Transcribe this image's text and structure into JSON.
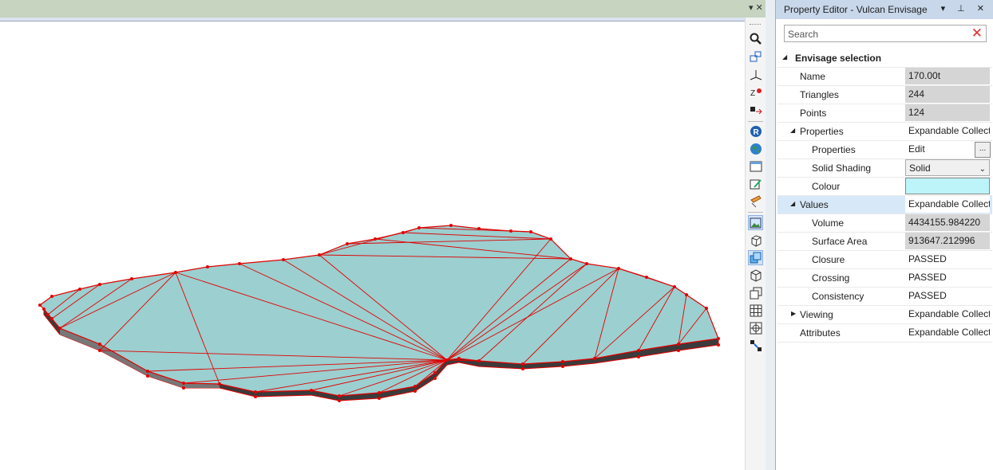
{
  "panel": {
    "title": "Property Editor - Vulcan Envisage",
    "title_controls": "▾ ⊥ ✕",
    "search_placeholder": "Search"
  },
  "viewport": {
    "controls": "▾ ✕"
  },
  "properties": {
    "envisage_selection": "Envisage selection",
    "name_label": "Name",
    "name_value": "170.00t",
    "triangles_label": "Triangles",
    "triangles_value": "244",
    "points_label": "Points",
    "points_value": "124",
    "properties_label": "Properties",
    "properties_value": "Expandable Collect",
    "sub_properties_label": "Properties",
    "sub_properties_value": "Edit",
    "solid_shading_label": "Solid Shading",
    "solid_shading_value": "Solid",
    "colour_label": "Colour",
    "values_label": "Values",
    "values_value": "Expandable Collect",
    "volume_label": "Volume",
    "volume_value": "4434155.984220",
    "surface_area_label": "Surface Area",
    "surface_area_value": "913647.212996",
    "closure_label": "Closure",
    "closure_value": "PASSED",
    "crossing_label": "Crossing",
    "crossing_value": "PASSED",
    "consistency_label": "Consistency",
    "consistency_value": "PASSED",
    "viewing_label": "Viewing",
    "viewing_value": "Expandable Collect",
    "attributes_label": "Attributes",
    "attributes_value": "Expandable Collect"
  },
  "colors": {
    "colour_swatch": "#bdf4fa",
    "solid_fill": "#9ccfcf",
    "wireframe": "#e00000"
  },
  "toolbar_icons": [
    "search-icon",
    "view-box-icon",
    "axes-icon",
    "point-icon",
    "move-icon",
    "r-icon",
    "globe-icon",
    "window-icon",
    "edit-icon",
    "pencil-icon",
    "image-icon",
    "cube-icon",
    "layers-icon",
    "wire-cube-icon",
    "copy-icon",
    "grid-icon",
    "grid-target-icon",
    "link-icon"
  ]
}
